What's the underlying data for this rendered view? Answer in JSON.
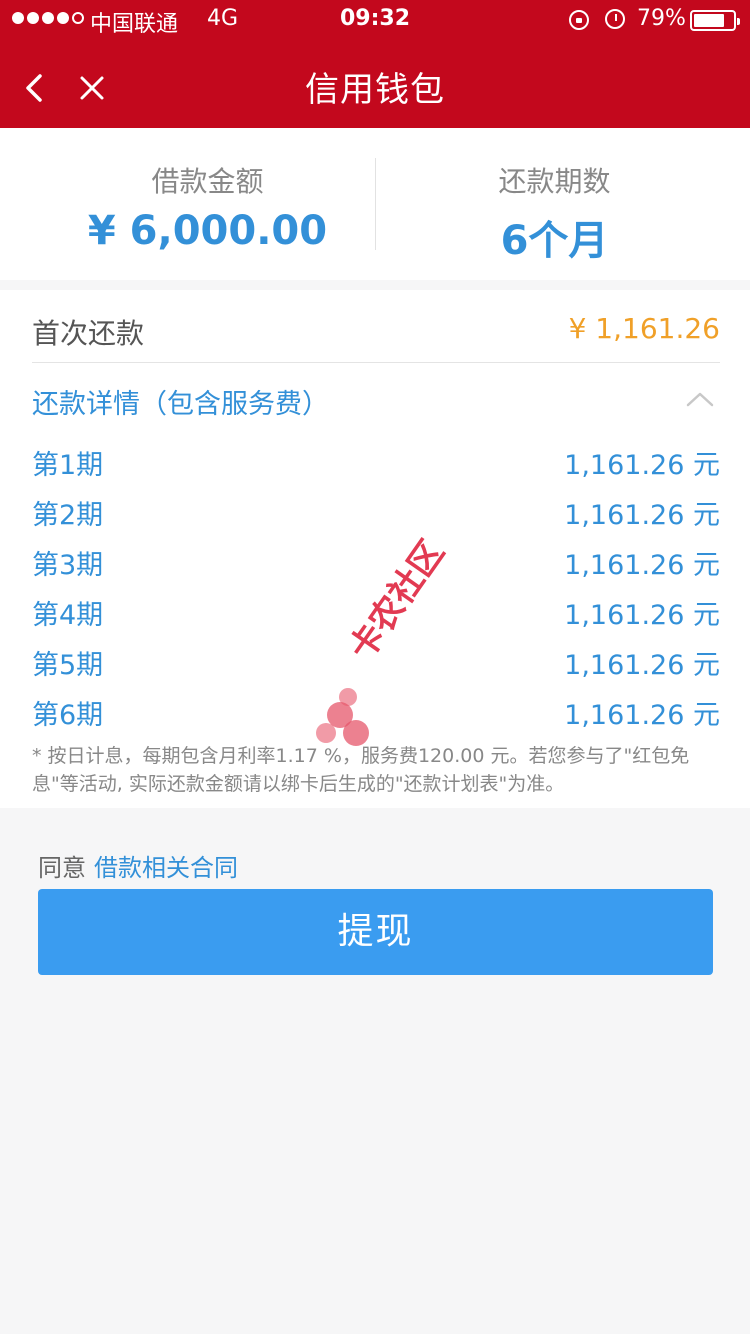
{
  "status_bar": {
    "carrier": "中国联通",
    "network": "4G",
    "time": "09:32",
    "battery": "79%",
    "battery_level": 0.79
  },
  "header": {
    "title": "信用钱包"
  },
  "summary": {
    "amount_label": "借款金额",
    "amount_value": "¥ 6,000.00",
    "term_label": "还款期数",
    "term_value": "6个月"
  },
  "first_payment": {
    "label": "首次还款",
    "value": "¥ 1,161.26"
  },
  "details": {
    "title": "还款详情（包含服务费）",
    "periods": [
      {
        "label": "第1期",
        "value": "1,161.26 元"
      },
      {
        "label": "第2期",
        "value": "1,161.26 元"
      },
      {
        "label": "第3期",
        "value": "1,161.26 元"
      },
      {
        "label": "第4期",
        "value": "1,161.26 元"
      },
      {
        "label": "第5期",
        "value": "1,161.26 元"
      },
      {
        "label": "第6期",
        "value": "1,161.26 元"
      }
    ],
    "note": "* 按日计息，每期包含月利率1.17 %，服务费120.00 元。若您参与了\"红包免息\"等活动, 实际还款金额请以绑卡后生成的\"还款计划表\"为准。"
  },
  "watermark": {
    "text": "卡农社区"
  },
  "agreement": {
    "prefix": "同意",
    "link": "借款相关合同"
  },
  "submit": {
    "label": "提现"
  },
  "colors": {
    "header": "#c3081d",
    "accent": "#3390d8",
    "button": "#3a9cf0",
    "highlight": "#f0a028"
  }
}
